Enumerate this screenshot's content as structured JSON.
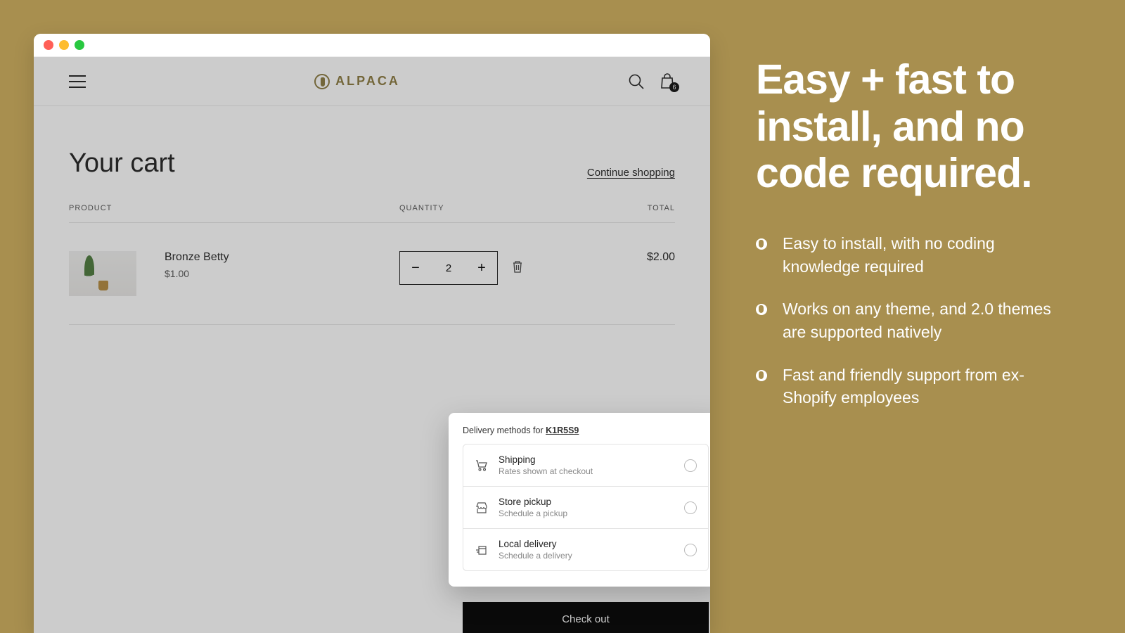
{
  "marketing": {
    "headline": "Easy + fast to install, and no code required.",
    "bullets": [
      "Easy to install, with no coding knowledge required",
      "Works on any theme, and 2.0 themes are supported natively",
      "Fast and friendly support from ex-Shopify employees"
    ]
  },
  "store": {
    "brand": "ALPACA",
    "cart_count": "6"
  },
  "cart": {
    "title": "Your cart",
    "continue_label": "Continue shopping",
    "headers": {
      "product": "PRODUCT",
      "quantity": "QUANTITY",
      "total": "TOTAL"
    },
    "line": {
      "name": "Bronze Betty",
      "unit_price": "$1.00",
      "qty": "2",
      "total": "$2.00"
    },
    "checkout_label": "Check out"
  },
  "delivery": {
    "title_prefix": "Delivery methods for ",
    "zip": "K1R5S9",
    "options": [
      {
        "title": "Shipping",
        "subtitle": "Rates shown at checkout",
        "icon": "cart"
      },
      {
        "title": "Store pickup",
        "subtitle": "Schedule a pickup",
        "icon": "store"
      },
      {
        "title": "Local delivery",
        "subtitle": "Schedule a delivery",
        "icon": "package"
      }
    ]
  }
}
